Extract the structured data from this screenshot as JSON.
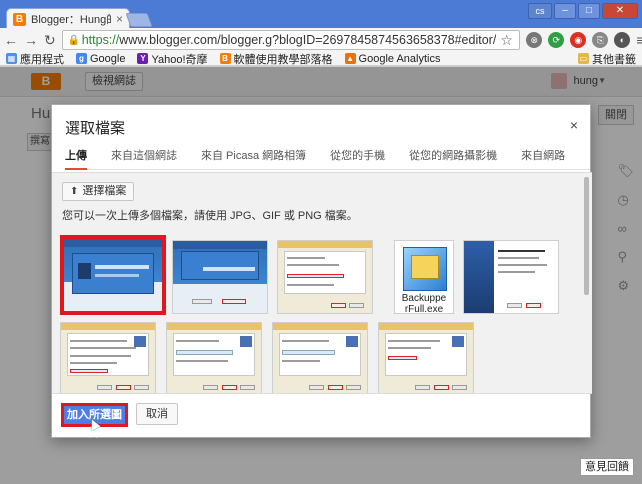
{
  "browser": {
    "tab_title": "Blogger：Hung的歡迎頁",
    "tab_close": "×",
    "window_user": "cs",
    "url_scheme": "https://",
    "url_rest": "www.blogger.com/blogger.g?blogID=2697845874563658378#editor/"
  },
  "bookmarks": [
    {
      "label": "應用程式",
      "color": "#4f8fe6",
      "glyph": "▦"
    },
    {
      "label": "Google",
      "color": "#4285f4",
      "glyph": "g"
    },
    {
      "label": "Yahoo!奇摩",
      "color": "#6b1fb1",
      "glyph": "Y"
    },
    {
      "label": "軟體使用教學部落格",
      "color": "#f57d00",
      "glyph": "B"
    },
    {
      "label": "Google Analytics",
      "color": "#e8710a",
      "glyph": "▲"
    }
  ],
  "bookmarks_other": "其他書籤",
  "blogger": {
    "logo": "B",
    "view_blog": "檢視網誌",
    "user": "hung",
    "post_title_peek": "Hung",
    "close_peek": "關閉",
    "compose_peek": "撰寫",
    "feedback": "意見回饋"
  },
  "dialog": {
    "title": "選取檔案",
    "close": "×",
    "tabs": [
      {
        "label": "上傳",
        "active": true
      },
      {
        "label": "來自這個網誌",
        "active": false
      },
      {
        "label": "來自 Picasa 網路相簿",
        "active": false
      },
      {
        "label": "從您的手機",
        "active": false
      },
      {
        "label": "從您的網路攝影機",
        "active": false
      },
      {
        "label": "來自網路",
        "active": false
      }
    ],
    "choose_button": "選擇檔案",
    "hint": "您可以一次上傳多個檔案，請使用 JPG、GIF 或 PNG 檔案。",
    "images": [
      {
        "kind": "blue",
        "selected": true
      },
      {
        "kind": "blue",
        "selected": false
      },
      {
        "kind": "dialog",
        "selected": false
      },
      {
        "kind": "installer",
        "selected": false,
        "label": "BackupperFull.exe"
      },
      {
        "kind": "dialog",
        "selected": false
      },
      {
        "kind": "dialog",
        "selected": false
      },
      {
        "kind": "dialog",
        "selected": false
      },
      {
        "kind": "dialog",
        "selected": false
      },
      {
        "kind": "dialog",
        "selected": false
      },
      {
        "kind": "dialog",
        "selected": false
      }
    ],
    "add_selected": "加入所選圖片",
    "cancel": "取消"
  }
}
